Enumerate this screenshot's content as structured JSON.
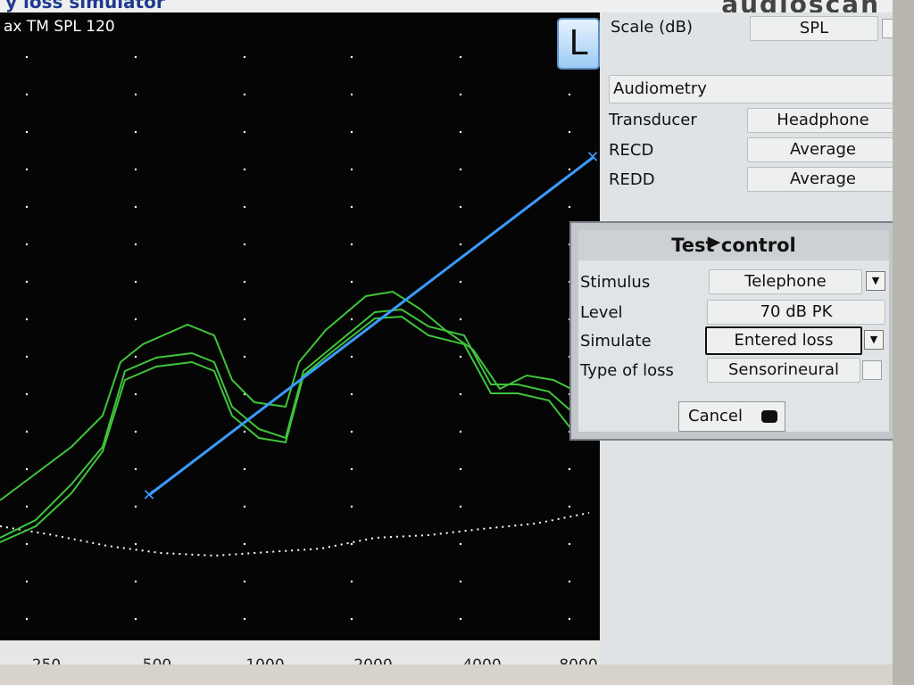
{
  "app": {
    "title_fragment": "y loss simulator",
    "logo": "audioscan"
  },
  "graph": {
    "scale_label": "ax TM SPL 120",
    "ear_button": "L",
    "x_ticks": [
      "250",
      "500",
      "1000",
      "2000",
      "4000",
      "8000"
    ]
  },
  "panel": {
    "scale_label": "Scale (dB)",
    "scale_value": "SPL",
    "section": "Audiometry",
    "transducer_label": "Transducer",
    "transducer_value": "Headphone",
    "recd_label": "RECD",
    "recd_value": "Average",
    "redd_label": "REDD",
    "redd_value": "Average"
  },
  "dialog": {
    "title": "Test control",
    "stimulus_label": "Stimulus",
    "stimulus_value": "Telephone",
    "level_label": "Level",
    "level_value": "70 dB PK",
    "simulate_label": "Simulate",
    "simulate_value": "Entered loss",
    "loss_label": "Type of loss",
    "loss_value": "Sensorineural",
    "cancel_label": "Cancel"
  },
  "colors": {
    "background": "#050505",
    "response": "#3fc43a",
    "target": "#3a9bff",
    "noise": "#ffffff"
  }
}
